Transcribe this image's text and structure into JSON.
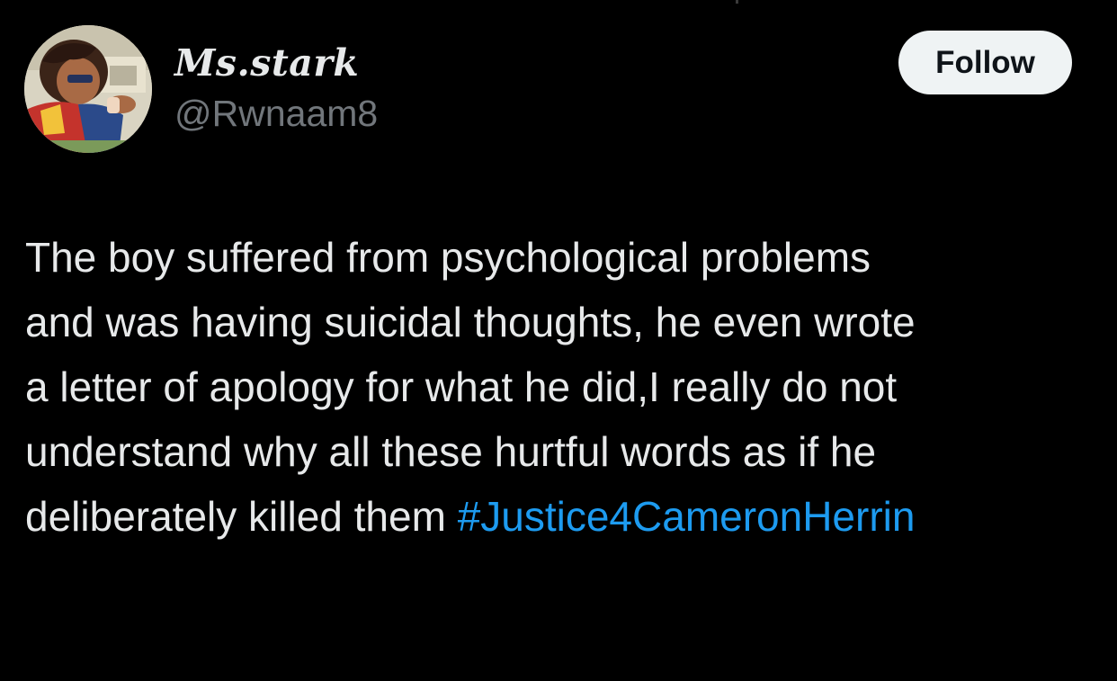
{
  "user": {
    "display_name": "Ms.stark",
    "handle": "@Rwnaam8",
    "avatar_icon": "cartoon-girl-avatar"
  },
  "actions": {
    "follow_label": "Follow"
  },
  "tweet": {
    "text": "The boy suffered from psychological problems\nand was having suicidal thoughts, he even wrote\na letter of apology for what he did,I really do not\nunderstand why all these hurtful words as if he\ndeliberately killed them ",
    "hashtag": "#Justice4CameronHerrin"
  },
  "colors": {
    "background": "#000000",
    "text": "#e7e9ea",
    "secondary_text": "#71767b",
    "link": "#1d9bf0",
    "button_bg": "#eff3f4",
    "button_text": "#0f1419"
  }
}
